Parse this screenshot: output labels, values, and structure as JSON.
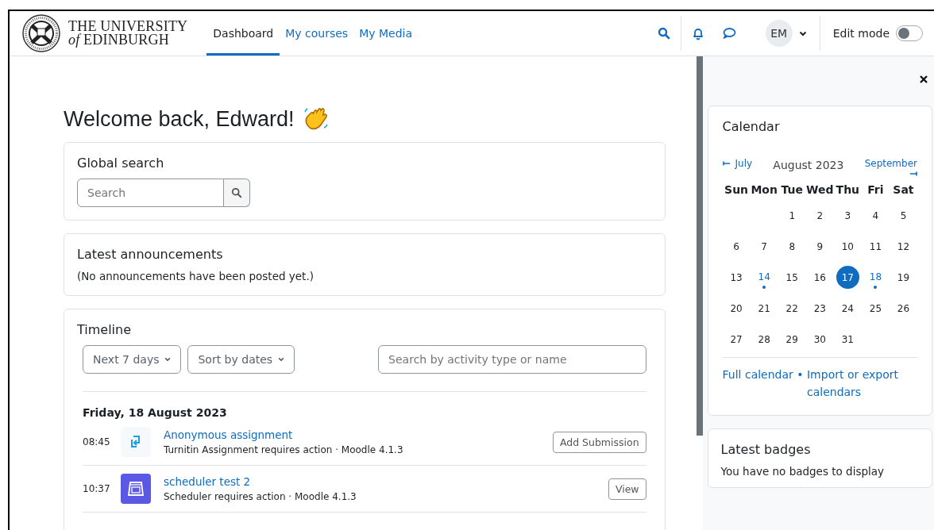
{
  "header": {
    "logo_line_1": "THE UNIVERSITY",
    "logo_line_2": "*of* EDINBURGH",
    "nav": [
      {
        "label": "Dashboard",
        "selected": true
      },
      {
        "label": "My courses",
        "selected": false
      },
      {
        "label": "My Media",
        "selected": false
      }
    ],
    "avatar": "EM",
    "edit_mode": {
      "label": "Edit mode",
      "on": false
    }
  },
  "welcome": "Welcome back, Edward!",
  "global_search": {
    "title": "Global search",
    "placeholder": "Search"
  },
  "announcements": {
    "title": "Latest announcements",
    "message": "(No announcements have been posted yet.)"
  },
  "timeline": {
    "title": "Timeline",
    "filter": "Next 7 days",
    "sort": "Sort by dates",
    "placeholder": "Search by activity type or name",
    "date": "Friday, 18 August 2023",
    "items": [
      {
        "time": "08:45",
        "kind": "turnitin",
        "title": "Anonymous assignment",
        "subtitle": "Turnitin Assignment requires action · Moodle 4.1.3",
        "action": "Add Submission"
      },
      {
        "time": "10:37",
        "kind": "scheduler",
        "title": "scheduler test 2",
        "subtitle": "Scheduler requires action · Moodle 4.1.3",
        "action": "View"
      }
    ]
  },
  "calendar": {
    "title": "Calendar",
    "prev": "July",
    "month": "August 2023",
    "next": "September",
    "weekdays": [
      "Sun",
      "Mon",
      "Tue",
      "Wed",
      "Thu",
      "Fri",
      "Sat"
    ],
    "weeks": [
      {
        "kind": "first",
        "days": [
          {
            "day": "1",
            "today": false,
            "event": false
          },
          {
            "day": "2",
            "today": false,
            "event": false
          },
          {
            "day": "3",
            "today": false,
            "event": false
          },
          {
            "day": "4",
            "today": false,
            "event": false
          },
          {
            "day": "5",
            "today": false,
            "event": false
          }
        ]
      },
      {
        "kind": "full",
        "days": [
          {
            "day": "6",
            "today": false,
            "event": false
          },
          {
            "day": "7",
            "today": false,
            "event": false
          },
          {
            "day": "8",
            "today": false,
            "event": false
          },
          {
            "day": "9",
            "today": false,
            "event": false
          },
          {
            "day": "10",
            "today": false,
            "event": false
          },
          {
            "day": "11",
            "today": false,
            "event": false
          },
          {
            "day": "12",
            "today": false,
            "event": false
          }
        ]
      },
      {
        "kind": "full",
        "days": [
          {
            "day": "13",
            "today": false,
            "event": false
          },
          {
            "day": "14",
            "today": false,
            "event": true
          },
          {
            "day": "15",
            "today": false,
            "event": false
          },
          {
            "day": "16",
            "today": false,
            "event": false
          },
          {
            "day": "17",
            "today": true,
            "event": false
          },
          {
            "day": "18",
            "today": false,
            "event": true
          },
          {
            "day": "19",
            "today": false,
            "event": false
          }
        ]
      },
      {
        "kind": "full",
        "days": [
          {
            "day": "20",
            "today": false,
            "event": false
          },
          {
            "day": "21",
            "today": false,
            "event": false
          },
          {
            "day": "22",
            "today": false,
            "event": false
          },
          {
            "day": "23",
            "today": false,
            "event": false
          },
          {
            "day": "24",
            "today": false,
            "event": false
          },
          {
            "day": "25",
            "today": false,
            "event": false
          },
          {
            "day": "26",
            "today": false,
            "event": false
          }
        ]
      },
      {
        "kind": "last",
        "days": [
          {
            "day": "27",
            "today": false,
            "event": false
          },
          {
            "day": "28",
            "today": false,
            "event": false
          },
          {
            "day": "29",
            "today": false,
            "event": false
          },
          {
            "day": "30",
            "today": false,
            "event": false
          },
          {
            "day": "31",
            "today": false,
            "event": false
          }
        ]
      }
    ],
    "full_link": "Full calendar",
    "separator": "•",
    "import_link": "Import or export calendars"
  },
  "badges": {
    "title": "Latest badges",
    "message": "You have no badges to display"
  }
}
